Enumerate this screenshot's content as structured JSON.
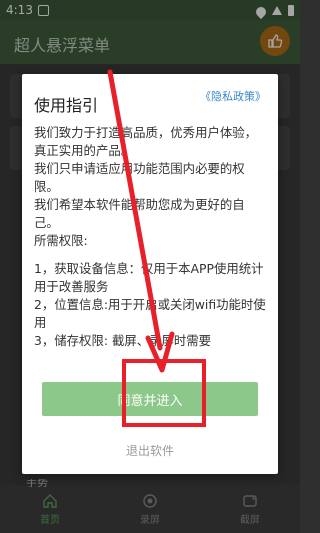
{
  "status_bar": {
    "time": "4:13"
  },
  "app_bar": {
    "title": "超人悬浮菜单"
  },
  "dialog": {
    "title": "使用指引",
    "privacy_link": "《隐私政策》",
    "paragraphs": [
      "我们致力于打造高品质，优秀用户体验，真正实用的产品。",
      "我们只申请适应用功能范围内必要的权限。",
      "我们希望本软件能帮助您成为更好的自己。",
      "所需权限:",
      "1，获取设备信息：仅用于本APP使用统计用于改善服务",
      "2，位置信息:用于开启或关闭wifi功能时使用",
      "3，储存权限: 截屏、录屏时需要"
    ],
    "agree_label": "同意并进入",
    "exit_label": "退出软件"
  },
  "background": {
    "partial_item": "手势"
  },
  "bottom_nav": {
    "items": [
      {
        "label": "首页",
        "icon": "home-icon"
      },
      {
        "label": "录屏",
        "icon": "record-icon"
      },
      {
        "label": "截屏",
        "icon": "screenshot-icon"
      }
    ]
  },
  "colors": {
    "accent": "#8cc88a",
    "appbar": "#3f5e3d",
    "link": "#3a86c8",
    "annotation": "#e8202a"
  }
}
